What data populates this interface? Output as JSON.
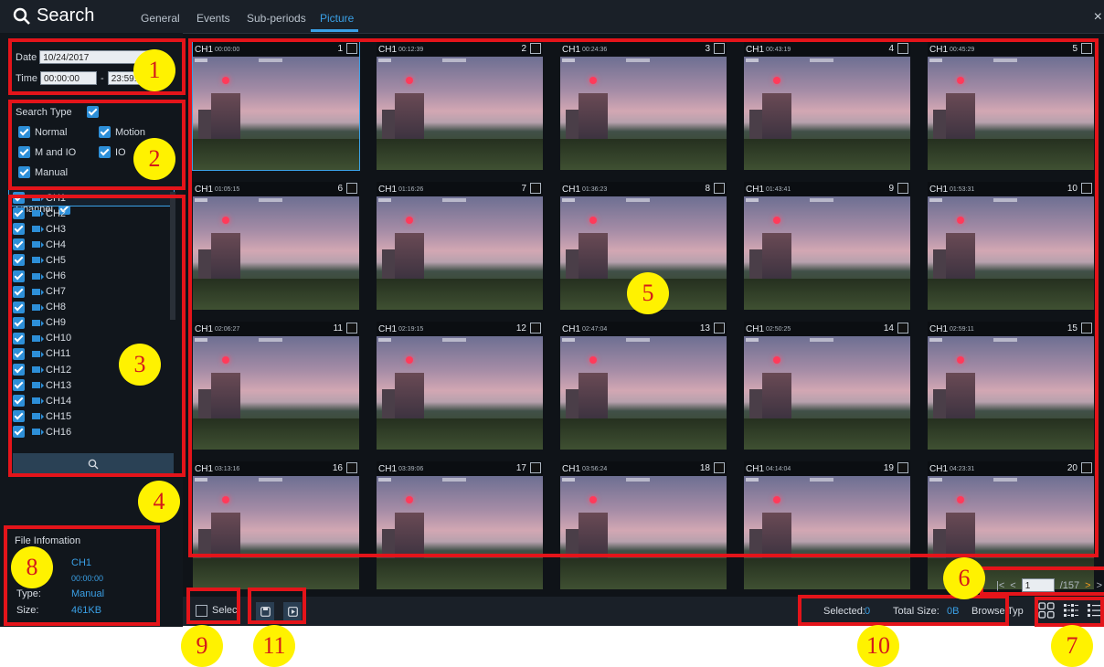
{
  "header": {
    "title": "Search",
    "tabs": [
      {
        "label": "General"
      },
      {
        "label": "Events"
      },
      {
        "label": "Sub-periods"
      },
      {
        "label": "Picture"
      }
    ],
    "active_tab": "Picture",
    "close_glyph": "×"
  },
  "date_time": {
    "date_label": "Date",
    "date_value": "10/24/2017",
    "time_label": "Time",
    "start_time": "00:00:00",
    "separator": "-",
    "end_time": "23:59:"
  },
  "search_type": {
    "label": "Search Type",
    "options": [
      "Normal",
      "Motion",
      "M and IO",
      "IO",
      "Manual"
    ]
  },
  "channels": {
    "label": "Channel",
    "items": [
      "CH1",
      "CH2",
      "CH3",
      "CH4",
      "CH5",
      "CH6",
      "CH7",
      "CH8",
      "CH9",
      "CH10",
      "CH11",
      "CH12",
      "CH13",
      "CH14",
      "CH15",
      "CH16"
    ],
    "selected": "CH1"
  },
  "search_button_icon": "magnifier-icon",
  "thumbnails": [
    {
      "ch": "CH1",
      "time": "00:00:00",
      "n": "1"
    },
    {
      "ch": "CH1",
      "time": "00:12:39",
      "n": "2"
    },
    {
      "ch": "CH1",
      "time": "00:24:36",
      "n": "3"
    },
    {
      "ch": "CH1",
      "time": "00:43:19",
      "n": "4"
    },
    {
      "ch": "CH1",
      "time": "00:45:29",
      "n": "5"
    },
    {
      "ch": "CH1",
      "time": "01:05:15",
      "n": "6"
    },
    {
      "ch": "CH1",
      "time": "01:16:26",
      "n": "7"
    },
    {
      "ch": "CH1",
      "time": "01:36:23",
      "n": "8"
    },
    {
      "ch": "CH1",
      "time": "01:43:41",
      "n": "9"
    },
    {
      "ch": "CH1",
      "time": "01:53:31",
      "n": "10"
    },
    {
      "ch": "CH1",
      "time": "02:06:27",
      "n": "11"
    },
    {
      "ch": "CH1",
      "time": "02:19:15",
      "n": "12"
    },
    {
      "ch": "CH1",
      "time": "02:47:04",
      "n": "13"
    },
    {
      "ch": "CH1",
      "time": "02:50:25",
      "n": "14"
    },
    {
      "ch": "CH1",
      "time": "02:59:11",
      "n": "15"
    },
    {
      "ch": "CH1",
      "time": "03:13:16",
      "n": "16"
    },
    {
      "ch": "CH1",
      "time": "03:39:06",
      "n": "17"
    },
    {
      "ch": "CH1",
      "time": "03:56:24",
      "n": "18"
    },
    {
      "ch": "CH1",
      "time": "04:14:04",
      "n": "19"
    },
    {
      "ch": "CH1",
      "time": "04:23:31",
      "n": "20"
    }
  ],
  "pager": {
    "first": "|<",
    "prev": "<",
    "current": "1",
    "total": "/157",
    "next": ">",
    "last": ">"
  },
  "file_info": {
    "title": "File Infomation",
    "channel": "CH1",
    "time": "00:00:00",
    "type_label": "Type:",
    "type_value": "Manual",
    "size_label": "Size:",
    "size_value": "461KB"
  },
  "bottom": {
    "select_label": "Selec",
    "selected_label": "Selected:",
    "selected_value": "0",
    "total_size_label": "Total Size:",
    "total_size_value": "0B",
    "browse_label": "Browse",
    "type_label": "Typ"
  },
  "annotations": [
    "1",
    "2",
    "3",
    "4",
    "5",
    "6",
    "7",
    "8",
    "9",
    "10",
    "11"
  ],
  "colors": {
    "accent": "#3aa0e6",
    "annotation_border": "#e4141a",
    "badge_fill": "#fff200",
    "badge_text": "#d41a1a"
  }
}
